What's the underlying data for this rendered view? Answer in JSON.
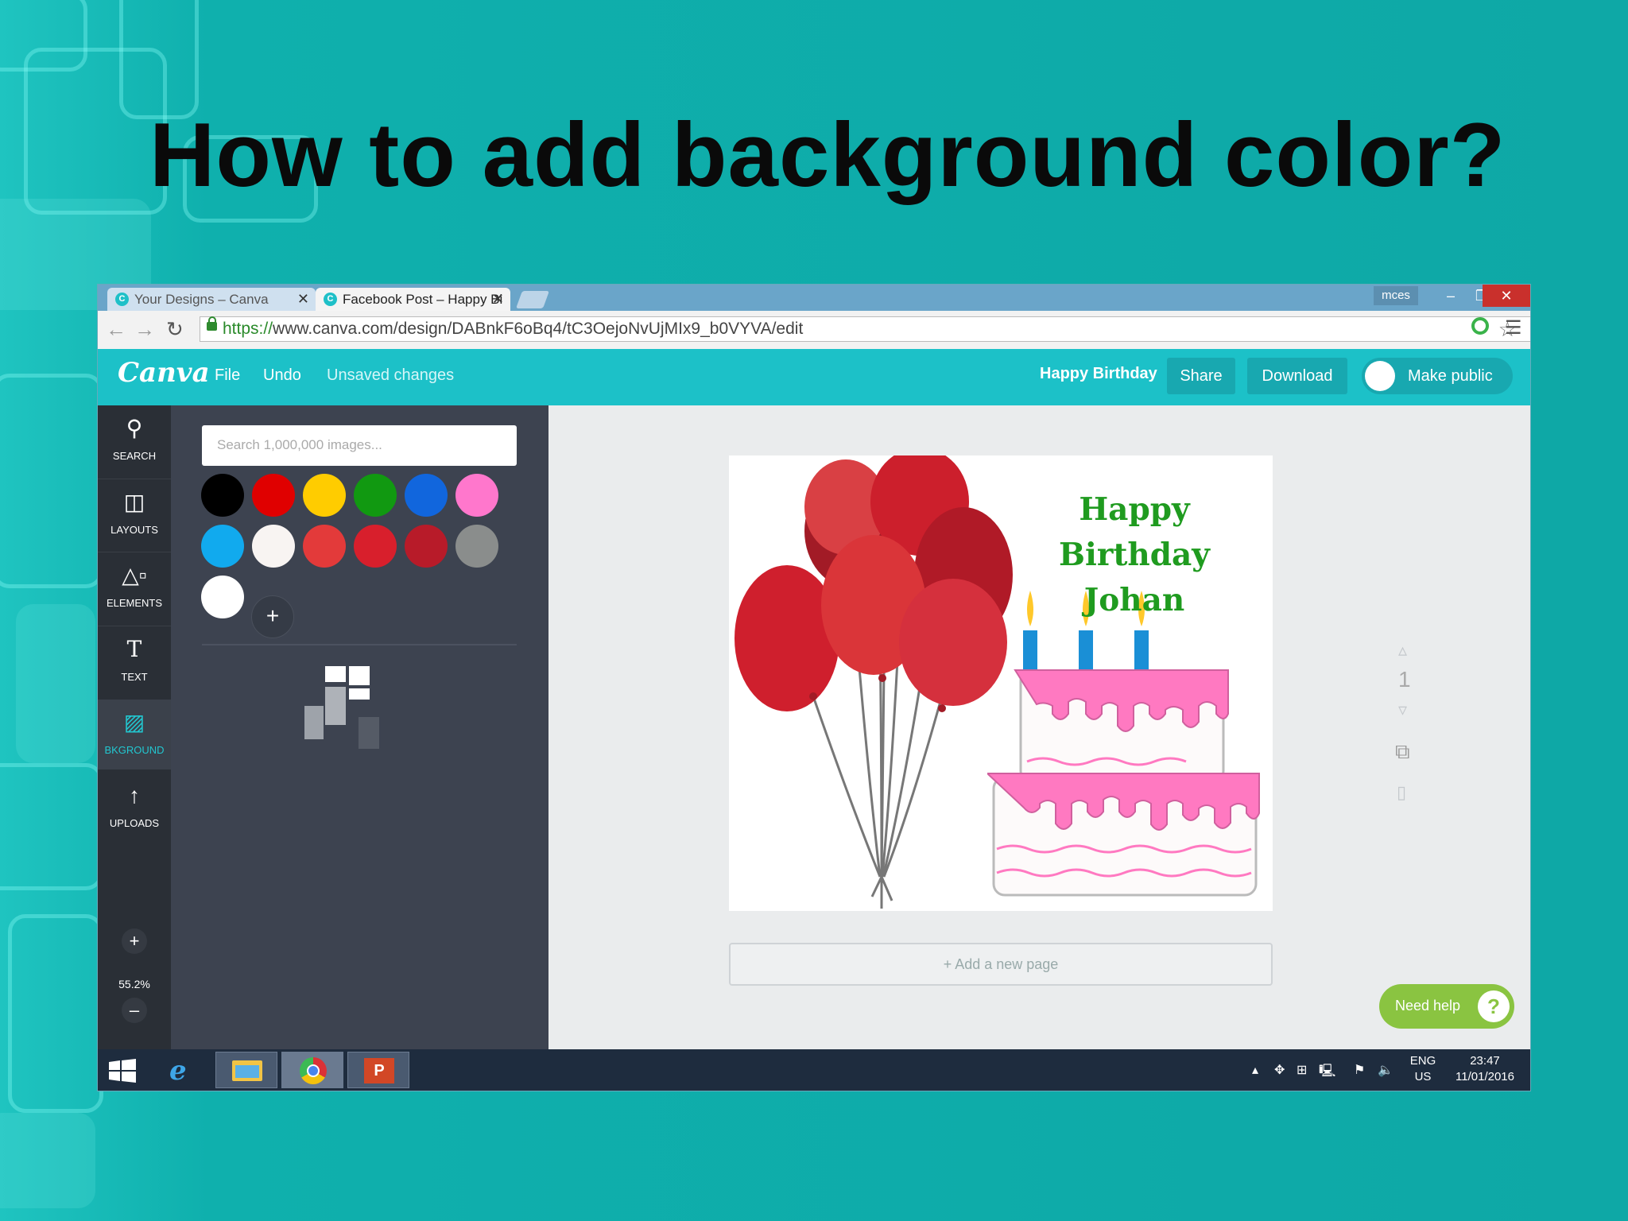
{
  "slide": {
    "title": "How to add background color?"
  },
  "browser": {
    "tabs": [
      {
        "label": "Your Designs – Canva",
        "active": false
      },
      {
        "label": "Facebook Post – Happy Bi",
        "active": true
      }
    ],
    "user_badge": "mces",
    "url_protocol": "https://",
    "url_rest": "www.canva.com/design/DABnkF6oBq4/tC3OejoNvUjMIx9_b0VYVA/edit"
  },
  "canva": {
    "logo": "Canva",
    "menu": {
      "file": "File",
      "undo": "Undo",
      "status": "Unsaved changes"
    },
    "design_title": "Happy Birthday",
    "share": "Share",
    "download": "Download",
    "make_public": "Make public"
  },
  "rail": {
    "items": [
      {
        "label": "SEARCH",
        "icon": "search-icon"
      },
      {
        "label": "LAYOUTS",
        "icon": "layouts-icon"
      },
      {
        "label": "ELEMENTS",
        "icon": "elements-icon"
      },
      {
        "label": "TEXT",
        "icon": "text-icon"
      },
      {
        "label": "BKGROUND",
        "icon": "background-icon"
      },
      {
        "label": "UPLOADS",
        "icon": "upload-icon"
      }
    ],
    "zoom": "55.2%"
  },
  "panel": {
    "search_placeholder": "Search 1,000,000 images...",
    "swatches": [
      "#000000",
      "#e00000",
      "#ffcc00",
      "#119911",
      "#1166dd",
      "#ff77cc",
      "#11aaee",
      "#f8f4f2",
      "#e33a3a",
      "#d81f2c",
      "#b81b29",
      "#8a8d8c",
      "#ffffff"
    ]
  },
  "canvas": {
    "card_title_line1": "Happy Birthday",
    "card_title_line2": "Johan",
    "page_number": "1",
    "add_page": "+ Add a new page",
    "need_help": "Need help"
  },
  "taskbar": {
    "lang1": "ENG",
    "lang2": "US",
    "time": "23:47",
    "date": "11/01/2016"
  }
}
